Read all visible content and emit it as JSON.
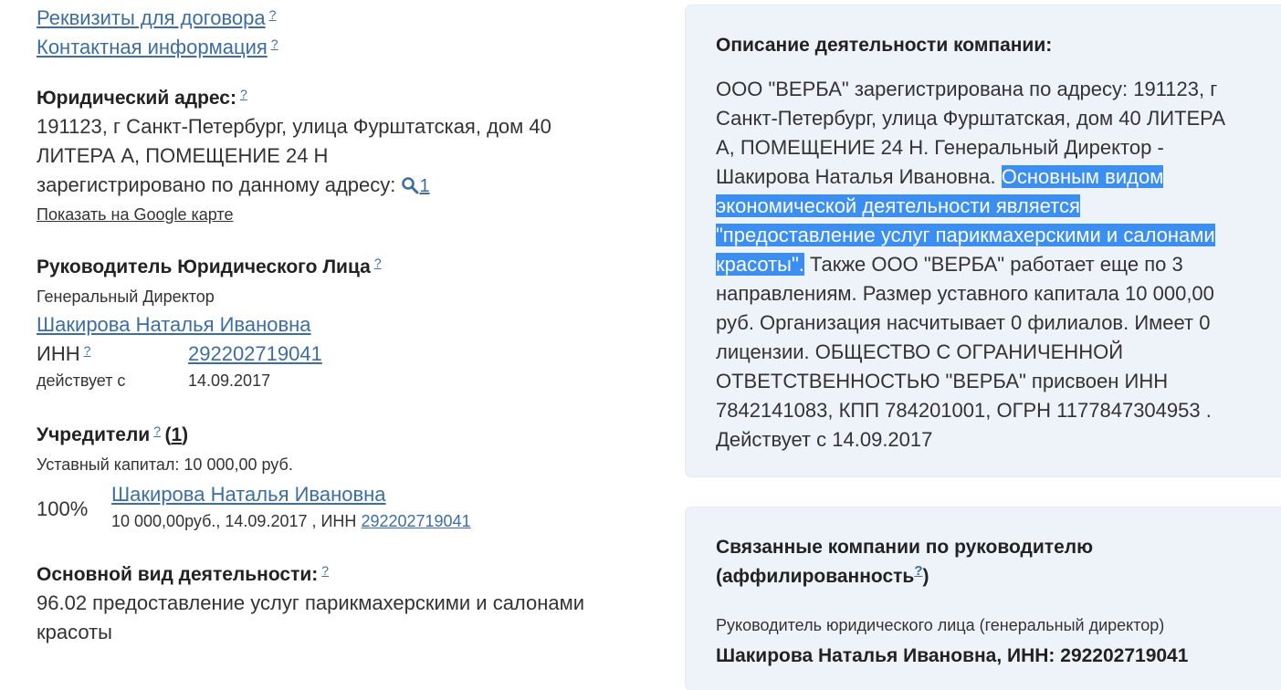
{
  "left": {
    "links": {
      "requisites": "Реквизиты для договора",
      "contacts": "Контактная информация"
    },
    "help_mark": "?",
    "address": {
      "heading": "Юридический адрес:",
      "line1": "191123, г Санкт-Петербург, улица Фурштатская, дом 40",
      "line2": "ЛИТЕРА А, ПОМЕЩЕНИЕ 24 Н",
      "registered_label": "зарегистрировано по данному адресу:",
      "registered_count": "1",
      "map_link": "Показать на Google карте"
    },
    "head": {
      "heading": "Руководитель Юридического Лица",
      "position": "Генеральный Директор",
      "name": "Шакирова Наталья Ивановна",
      "inn_label": "ИНН",
      "inn_value": "292202719041",
      "since_label": "действует с",
      "since_value": "14.09.2017"
    },
    "founders": {
      "heading": "Учредители",
      "count_open": "(",
      "count": "1",
      "count_close": ")",
      "capital": "Уставный капитал: 10 000,00 руб.",
      "share": "100%",
      "name": "Шакирова Наталья Ивановна",
      "details": "10 000,00руб., 14.09.2017 , ИНН",
      "inn": "292202719041"
    },
    "activity": {
      "heading": "Основной вид деятельности:",
      "line1": "96.02 предоставление услуг парикмахерскими и салонами",
      "line2": "красоты"
    }
  },
  "description": {
    "heading": "Описание деятельности компании:",
    "line1": "ООО \"ВЕРБА\" зарегистрирована по адресу: 191123, г",
    "line2": "Санкт-Петербург, улица Фурштатская, дом 40 ЛИТЕРА",
    "line3": "А, ПОМЕЩЕНИЕ 24 Н. Генеральный Директор -",
    "line4a": "Шакирова Наталья Ивановна. ",
    "line4b": "Основным видом",
    "line5": "экономической деятельности является ",
    "line6": "\"предоставление услуг парикмахерскими и салонами ",
    "line7a": "красоты\".",
    "line7b": " Также ООО \"ВЕРБА\" работает еще по 3",
    "line8": "направлениям. Размер уставного капитала 10 000,00",
    "line9": "руб. Организация насчитывает 0 филиалов. Имеет 0",
    "line10": "лицензии. ОБЩЕСТВО С ОГРАНИЧЕННОЙ",
    "line11": "ОТВЕТСТВЕННОСТЬЮ \"ВЕРБА\" присвоен ИНН",
    "line12": "7842141083, КПП 784201001, ОГРН 1177847304953 .",
    "line13": "Действует с 14.09.2017"
  },
  "affiliates": {
    "heading1": "Связанные компании по руководителю",
    "heading2_open": "(аффилированность",
    "heading2_close": ")",
    "subtitle": "Руководитель юридического лица (генеральный директор)",
    "person_line": "Шакирова Наталья Ивановна, ИНН: 292202719041"
  },
  "colors": {
    "link": "#3b6ea5",
    "selection": "#3b8ff2",
    "panel_bg": "#eef3f9"
  }
}
